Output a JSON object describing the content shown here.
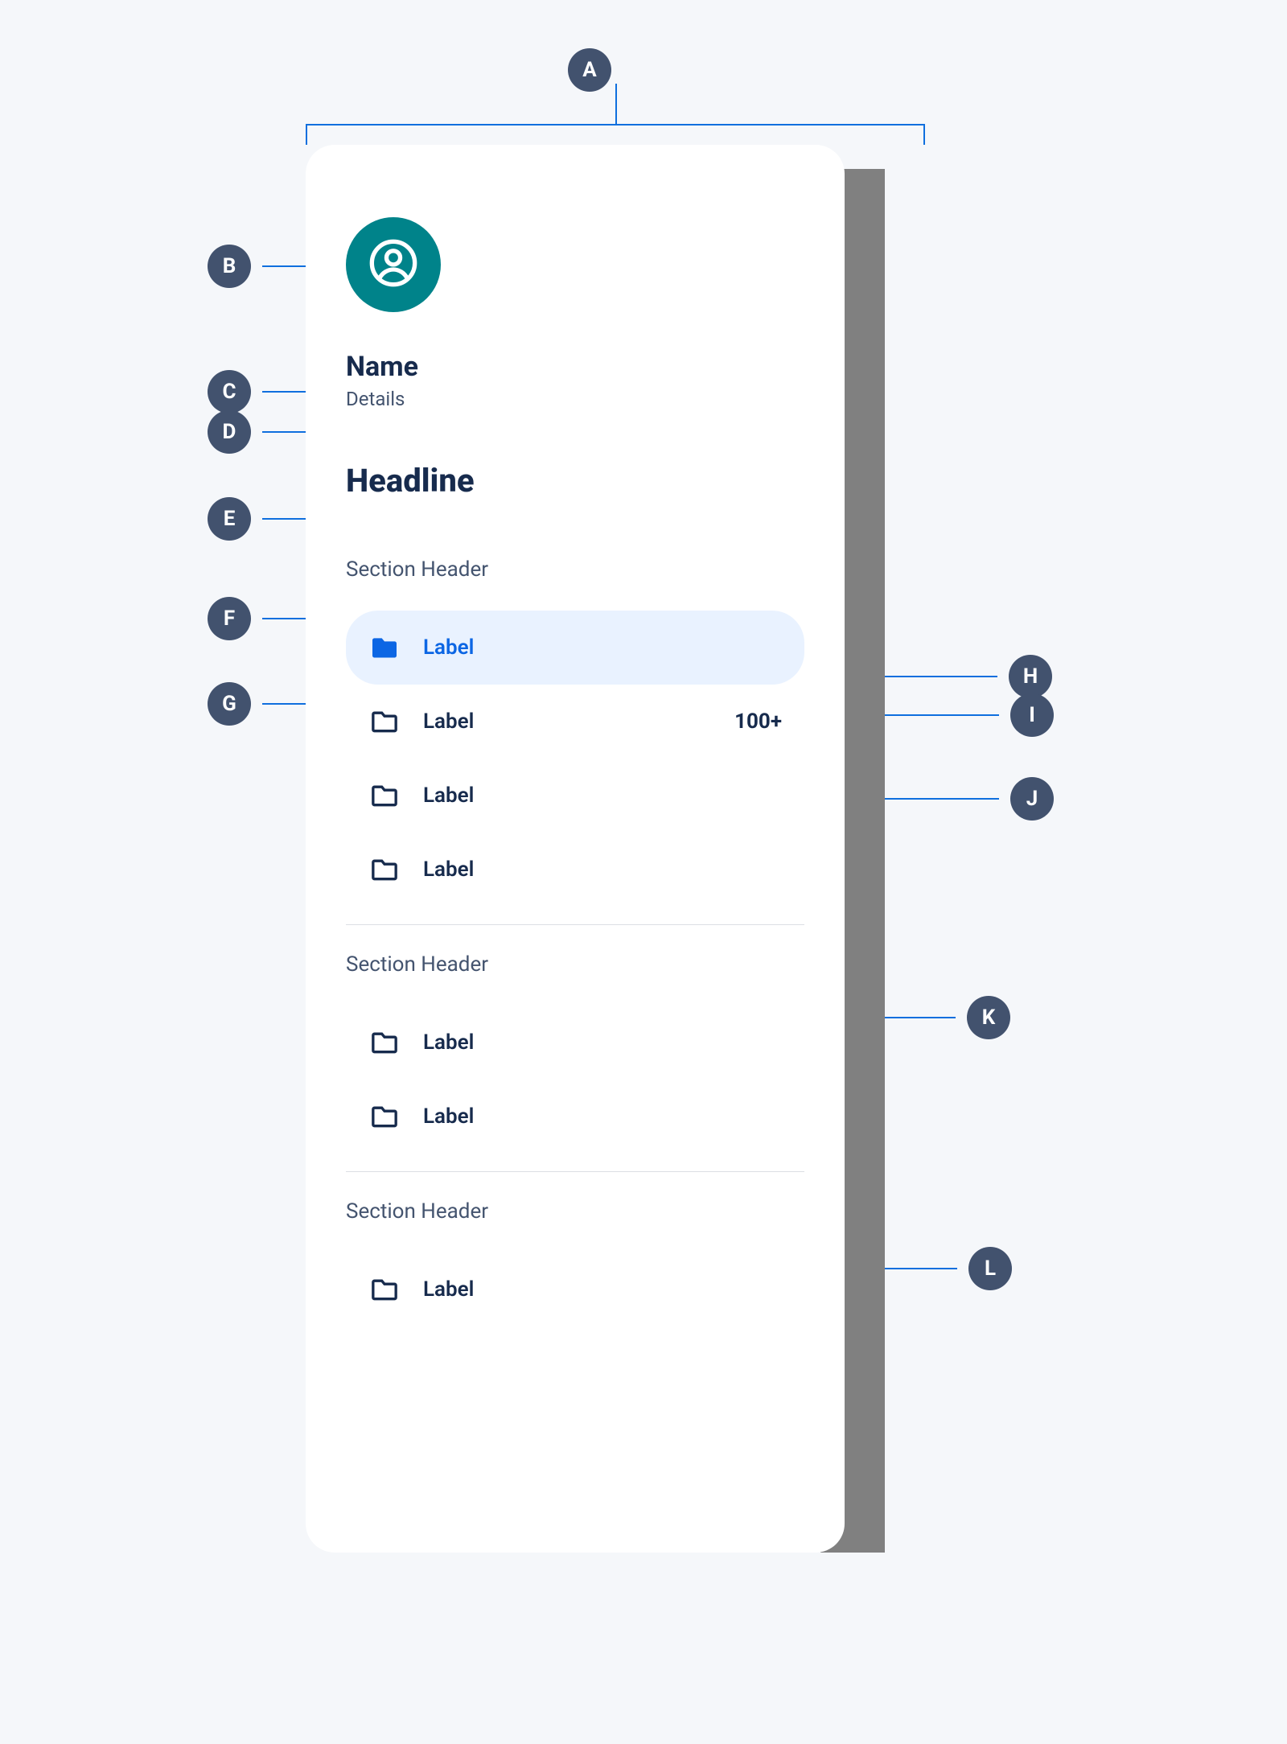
{
  "annotations": {
    "A": "A",
    "B": "B",
    "C": "C",
    "D": "D",
    "E": "E",
    "F": "F",
    "G": "G",
    "H": "H",
    "I": "I",
    "J": "J",
    "K": "K",
    "L": "L"
  },
  "drawer": {
    "name": "Name",
    "details": "Details",
    "headline": "Headline",
    "sections": [
      {
        "header": "Section Header",
        "items": [
          {
            "label": "Label",
            "active": true,
            "filled": true,
            "badge": ""
          },
          {
            "label": "Label",
            "active": false,
            "filled": false,
            "badge": "100+"
          },
          {
            "label": "Label",
            "active": false,
            "filled": false,
            "badge": ""
          },
          {
            "label": "Label",
            "active": false,
            "filled": false,
            "badge": ""
          }
        ]
      },
      {
        "header": "Section Header",
        "items": [
          {
            "label": "Label",
            "active": false,
            "filled": false,
            "badge": ""
          },
          {
            "label": "Label",
            "active": false,
            "filled": false,
            "badge": ""
          }
        ]
      },
      {
        "header": "Section Header",
        "items": [
          {
            "label": "Label",
            "active": false,
            "filled": false,
            "badge": ""
          }
        ]
      }
    ]
  }
}
